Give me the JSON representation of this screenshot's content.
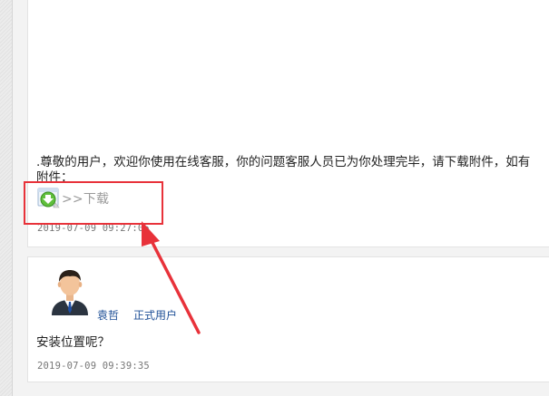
{
  "message_1": {
    "text_line1": ".尊敬的用户，欢迎你使用在线客服，你的问题客服人员已为你处理完毕，请下载附件，如有",
    "text_line2": "附件：",
    "attachment": {
      "link_label": ">>下载",
      "icon": "download-arrow-icon"
    },
    "timestamp": "2019-07-09 09:27:05"
  },
  "message_2": {
    "user": {
      "name": "袁哲",
      "role": "正式用户",
      "avatar": "user-avatar-icon"
    },
    "text": "安装位置呢？",
    "timestamp": "2019-07-09 09:39:35"
  },
  "annotation": {
    "color": "#e8323a"
  }
}
